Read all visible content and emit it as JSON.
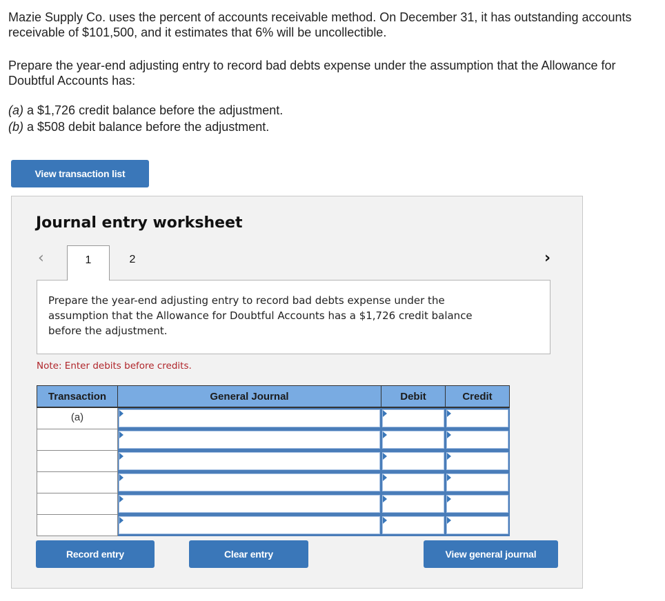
{
  "problem": {
    "intro": "Mazie Supply Co. uses the percent of accounts receivable method. On December 31, it has outstanding accounts receivable of $101,500, and it estimates that 6% will be uncollectible.",
    "instruction": "Prepare the year-end adjusting entry to record bad debts expense under the assumption that the Allowance for Doubtful Accounts has:",
    "parts": [
      {
        "label": "(a)",
        "text": " a $1,726 credit balance before the adjustment."
      },
      {
        "label": "(b)",
        "text": " a $508 debit balance before the adjustment."
      }
    ]
  },
  "buttons": {
    "view_transaction_list": "View transaction list",
    "record_entry": "Record entry",
    "clear_entry": "Clear entry",
    "view_general_journal": "View general journal"
  },
  "worksheet": {
    "title": "Journal entry worksheet",
    "prev_icon": "chevron-left-icon",
    "next_icon": "chevron-right-icon",
    "prev_glyph": "‹",
    "next_glyph": "›",
    "tabs": [
      {
        "label": "1",
        "active": true
      },
      {
        "label": "2",
        "active": false
      }
    ],
    "prompt": "Prepare the year-end adjusting entry to record bad debts expense under the assumption that the Allowance for Doubtful Accounts has a $1,726 credit balance before the adjustment.",
    "note": "Note: Enter debits before credits."
  },
  "journal_table": {
    "headers": [
      "Transaction",
      "General Journal",
      "Debit",
      "Credit"
    ],
    "rows": [
      {
        "transaction": "(a)",
        "account": "",
        "debit": "",
        "credit": ""
      },
      {
        "transaction": "",
        "account": "",
        "debit": "",
        "credit": ""
      },
      {
        "transaction": "",
        "account": "",
        "debit": "",
        "credit": ""
      },
      {
        "transaction": "",
        "account": "",
        "debit": "",
        "credit": ""
      },
      {
        "transaction": "",
        "account": "",
        "debit": "",
        "credit": ""
      },
      {
        "transaction": "",
        "account": "",
        "debit": "",
        "credit": ""
      }
    ]
  },
  "colors": {
    "button_blue": "#3a77b9",
    "header_blue": "#79abe2",
    "note_red": "#b0252a",
    "panel_gray": "#f2f2f2"
  }
}
